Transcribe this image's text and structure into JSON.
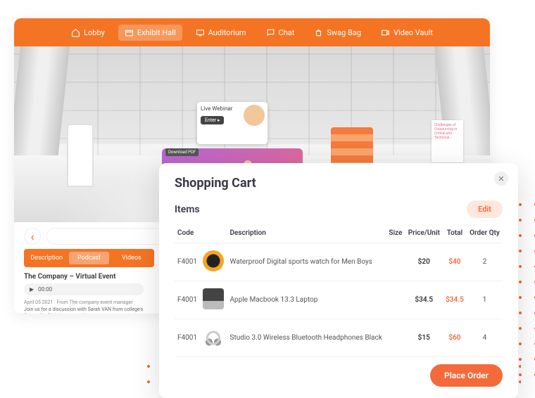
{
  "nav": {
    "items": [
      {
        "label": "Lobby",
        "icon": "home-icon"
      },
      {
        "label": "Exhibit Hall",
        "icon": "booth-icon",
        "active": true
      },
      {
        "label": "Auditorium",
        "icon": "screen-icon"
      },
      {
        "label": "Chat",
        "icon": "chat-icon"
      },
      {
        "label": "Swag Bag",
        "icon": "bag-icon"
      },
      {
        "label": "Video Vault",
        "icon": "video-icon"
      }
    ]
  },
  "booth": {
    "tv_label": "Live Webinar",
    "enter": "Enter ▸",
    "download": "Download PDF",
    "poster": "Challenges of Outsourcing in Critical and Technical..."
  },
  "tabs": {
    "items": [
      "Description",
      "Podcast",
      "Videos"
    ],
    "active": 1
  },
  "article": {
    "title": "The Company – Virtual Event",
    "audio_time": "00:00",
    "meta": "April 05 2021 · From The company event manager",
    "desc": "Join us for a discussion with Sarah VAN from college's Center for Global communities. https://openday.thecollege.edu/"
  },
  "cart": {
    "title": "Shopping Cart",
    "items_label": "Items",
    "edit": "Edit",
    "columns": [
      "Code",
      "",
      "Description",
      "Size",
      "Price/Unit",
      "Total",
      "Order Qty"
    ],
    "rows": [
      {
        "code": "F4001",
        "thumb": "th-watch",
        "desc": "Waterproof Digital sports watch for Men Boys",
        "size": "",
        "price": "$20",
        "total": "$40",
        "qty": "2"
      },
      {
        "code": "F4001",
        "thumb": "th-laptop",
        "desc": "Apple Macbook 13.3 Laptop",
        "size": "",
        "price": "$34.5",
        "total": "$34.5",
        "qty": "1"
      },
      {
        "code": "F4001",
        "thumb": "th-head",
        "desc": "Studio 3.0 Wireless Bluetooth Headphones Black",
        "size": "",
        "price": "$15",
        "total": "$60",
        "qty": "4"
      }
    ],
    "place_order": "Place Order"
  }
}
